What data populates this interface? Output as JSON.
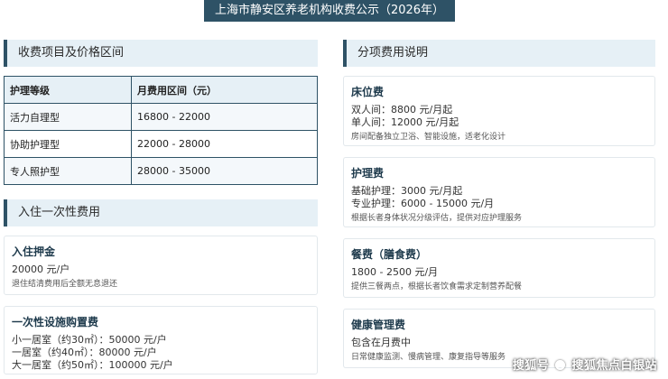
{
  "page_title": "上海市静安区养老机构收费公示（2026年）",
  "left": {
    "section_fees": "收费项目及价格区间",
    "table": {
      "headers": [
        "护理等级",
        "月费用区间（元）"
      ],
      "rows": [
        [
          "活力自理型",
          "16800 - 22000"
        ],
        [
          "协助护理型",
          "22000 - 28000"
        ],
        [
          "专人照护型",
          "28000 - 35000"
        ]
      ]
    },
    "section_onetime": "入住一次性费用",
    "deposit": {
      "title": "入住押金",
      "lines": [
        "20000 元/户"
      ],
      "note": "退住结清费用后全额无息退还"
    },
    "facility": {
      "title": "一次性设施购置费",
      "lines": [
        "小一居室（约30㎡）：50000 元/户",
        "一居室（约40㎡）：80000 元/户",
        "大一居室（约50㎡）：100000 元/户"
      ]
    }
  },
  "right": {
    "section_items": "分项费用说明",
    "bed": {
      "title": "床位费",
      "lines": [
        "双人间：8800 元/月起",
        "单人间：12000 元/月起"
      ],
      "note": "房间配备独立卫浴、智能设施，适老化设计"
    },
    "care": {
      "title": "护理费",
      "lines": [
        "基础护理：3000 元/月起",
        "专业护理：6000 - 15000 元/月"
      ],
      "note": "根据长者身体状况分级评估，提供对应护理服务"
    },
    "meal": {
      "title": "餐费（膳食费）",
      "lines": [
        "1800 - 2500 元/月"
      ],
      "note": "提供三餐两点，根据长者饮食需求定制营养配餐"
    },
    "health": {
      "title": "健康管理费",
      "lines": [
        "包含在月费中"
      ],
      "note": "日常健康监测、慢病管理、康复指导等服务"
    }
  },
  "watermark": {
    "prefix": "搜狐号",
    "suffix": "搜狐焦点白银站"
  }
}
